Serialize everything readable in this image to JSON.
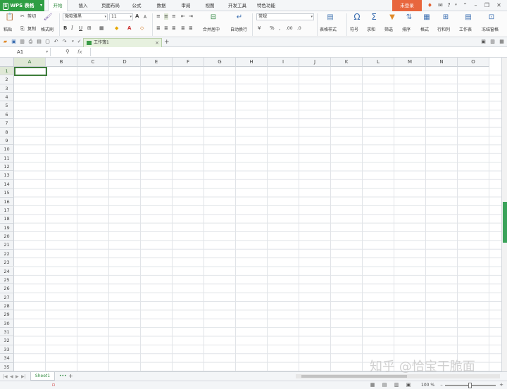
{
  "app": {
    "name": "WPS 表格",
    "logo": "S",
    "brand_color": "#2f9e44"
  },
  "menu_tabs": [
    "开始",
    "插入",
    "页面布局",
    "公式",
    "数据",
    "审阅",
    "视图",
    "开发工具",
    "特色功能"
  ],
  "active_menu_tab": "开始",
  "login_button": "未登录",
  "ribbon": {
    "paste": "粘贴",
    "cut": "剪切",
    "copy": "复制",
    "format_painter": "格式刷",
    "font_name": "微软雅黑",
    "font_size": "11",
    "bold": "B",
    "italic": "I",
    "underline": "U",
    "merge_center": "合并居中",
    "wrap_text": "自动换行",
    "number_format": "常规",
    "percent": "%",
    "table_style": "表格样式",
    "symbol": "符号",
    "sum": "求和",
    "filter": "筛选",
    "sort": "排序",
    "format": "格式",
    "row_col": "行和列",
    "worksheet": "工作表",
    "freeze": "冻结窗格"
  },
  "document_tab": "工作簿1",
  "name_box": "A1",
  "fx": "fx",
  "columns": [
    "A",
    "B",
    "C",
    "D",
    "E",
    "F",
    "G",
    "H",
    "I",
    "J",
    "K",
    "L",
    "M",
    "N",
    "O"
  ],
  "rows": [
    "1",
    "2",
    "3",
    "4",
    "5",
    "6",
    "7",
    "8",
    "9",
    "10",
    "11",
    "12",
    "13",
    "14",
    "15",
    "16",
    "17",
    "18",
    "19",
    "20",
    "21",
    "22",
    "23",
    "24",
    "25",
    "26",
    "27",
    "28",
    "29",
    "30",
    "31",
    "32",
    "33",
    "34",
    "35"
  ],
  "selected_cell": {
    "column": "A",
    "row": "1"
  },
  "sheet_tab": "Sheet1",
  "sheet_more": "•••",
  "zoom": "100 %",
  "watermark": "知乎 @恰宝干脆面",
  "icons": [
    "paste-icon",
    "cut-icon",
    "copy-icon",
    "format-painter-icon",
    "sum-icon",
    "filter-icon",
    "sort-icon",
    "symbol-icon"
  ]
}
